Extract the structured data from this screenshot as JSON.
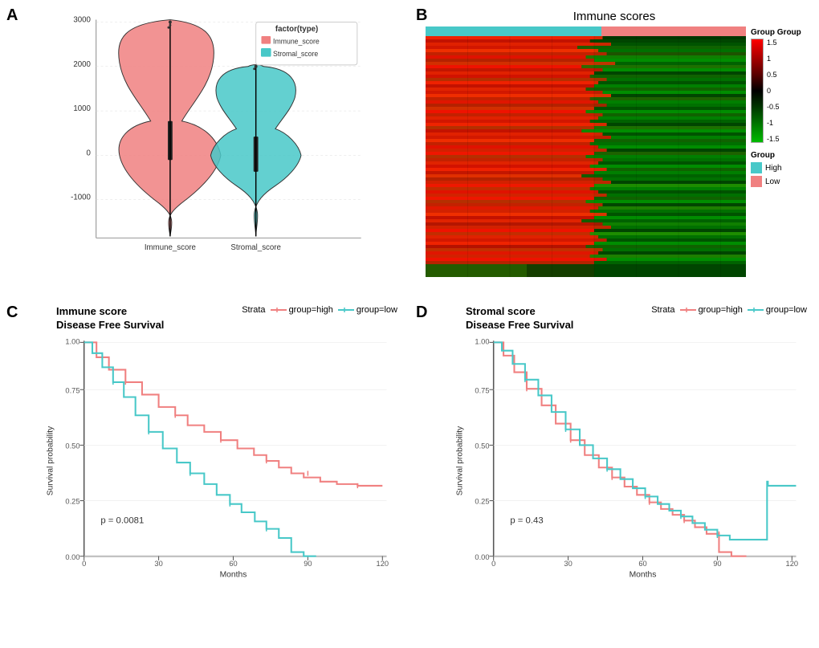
{
  "panels": {
    "a": {
      "label": "A",
      "legend_title": "factor(type)",
      "legend_items": [
        {
          "label": "Immune_score",
          "color": "#F08080"
        },
        {
          "label": "Stromal_score",
          "color": "#48C8C8"
        }
      ],
      "x_labels": [
        "Immune_score",
        "Stromal_score"
      ],
      "y_labels": [
        "3000",
        "2000",
        "1000",
        "0",
        "-1000"
      ],
      "violin1_color": "#F08080",
      "violin2_color": "#48C8C8"
    },
    "b": {
      "label": "B",
      "title": "Immune scores",
      "color_scale": [
        "1.5",
        "1",
        "0.5",
        "0",
        "-0.5",
        "-1",
        "-1.5"
      ],
      "group_legend": {
        "title": "Group",
        "items": [
          {
            "label": "High",
            "color": "#48C8C8"
          },
          {
            "label": "Low",
            "color": "#F08080"
          }
        ]
      },
      "top_groups_label": "Group",
      "top_groups": [
        "High",
        "Low"
      ]
    },
    "c": {
      "label": "C",
      "title_line1": "Immune score",
      "title_line2": "Disease Free Survival",
      "strata_label": "Strata",
      "strata_items": [
        {
          "label": "group=high",
          "color": "#F08080"
        },
        {
          "label": "group=low",
          "color": "#48C8C8"
        }
      ],
      "y_axis_label": "Survival probability",
      "x_axis_label": "Months",
      "x_ticks": [
        "0",
        "30",
        "60",
        "90",
        "120"
      ],
      "y_ticks": [
        "0.00",
        "0.25",
        "0.50",
        "0.75",
        "1.00"
      ],
      "p_value": "p = 0.0081"
    },
    "d": {
      "label": "D",
      "title_line1": "Stromal score",
      "title_line2": "Disease Free Survival",
      "strata_label": "Strata",
      "strata_items": [
        {
          "label": "group=high",
          "color": "#F08080"
        },
        {
          "label": "group=low",
          "color": "#48C8C8"
        }
      ],
      "y_axis_label": "Survival probability",
      "x_axis_label": "Months",
      "x_ticks": [
        "0",
        "30",
        "60",
        "90",
        "120"
      ],
      "y_ticks": [
        "0.00",
        "0.25",
        "0.50",
        "0.75",
        "1.00"
      ],
      "p_value": "p = 0.43"
    }
  }
}
